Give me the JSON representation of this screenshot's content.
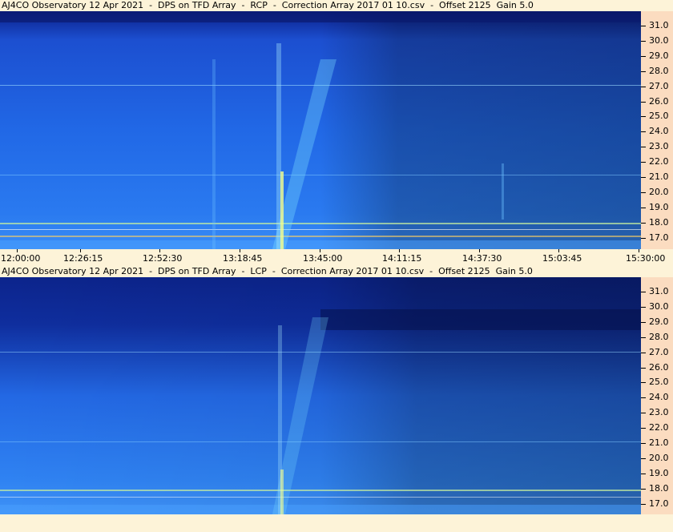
{
  "panels": [
    {
      "id": "rcp",
      "title": "AJ4CO Observatory 12 Apr 2021  -  DPS on TFD Array  -  RCP  -  Correction Array 2017 01 10.csv  -  Offset 2125  Gain 5.0"
    },
    {
      "id": "lcp",
      "title": "AJ4CO Observatory 12 Apr 2021  -  DPS on TFD Array  -  LCP  -  Correction Array 2017 01 10.csv  -  Offset 2125  Gain 5.0"
    }
  ],
  "frequency_ticks": [
    "31.0",
    "30.0",
    "29.0",
    "28.0",
    "27.0",
    "26.0",
    "25.0",
    "24.0",
    "23.0",
    "22.0",
    "21.0",
    "20.0",
    "19.0",
    "18.0",
    "17.0"
  ],
  "time_ticks": [
    "12:00:00",
    "12:26:15",
    "12:52:30",
    "13:18:45",
    "13:45:00",
    "14:11:15",
    "14:37:30",
    "15:03:45",
    "15:30:00"
  ],
  "colors": {
    "background": "#fdf3d8",
    "axis_panel": "#fbdcc0",
    "spectro_base": "#1a52d6",
    "spectro_dark": "#0a1a78",
    "burst": "#7be0ff"
  }
}
